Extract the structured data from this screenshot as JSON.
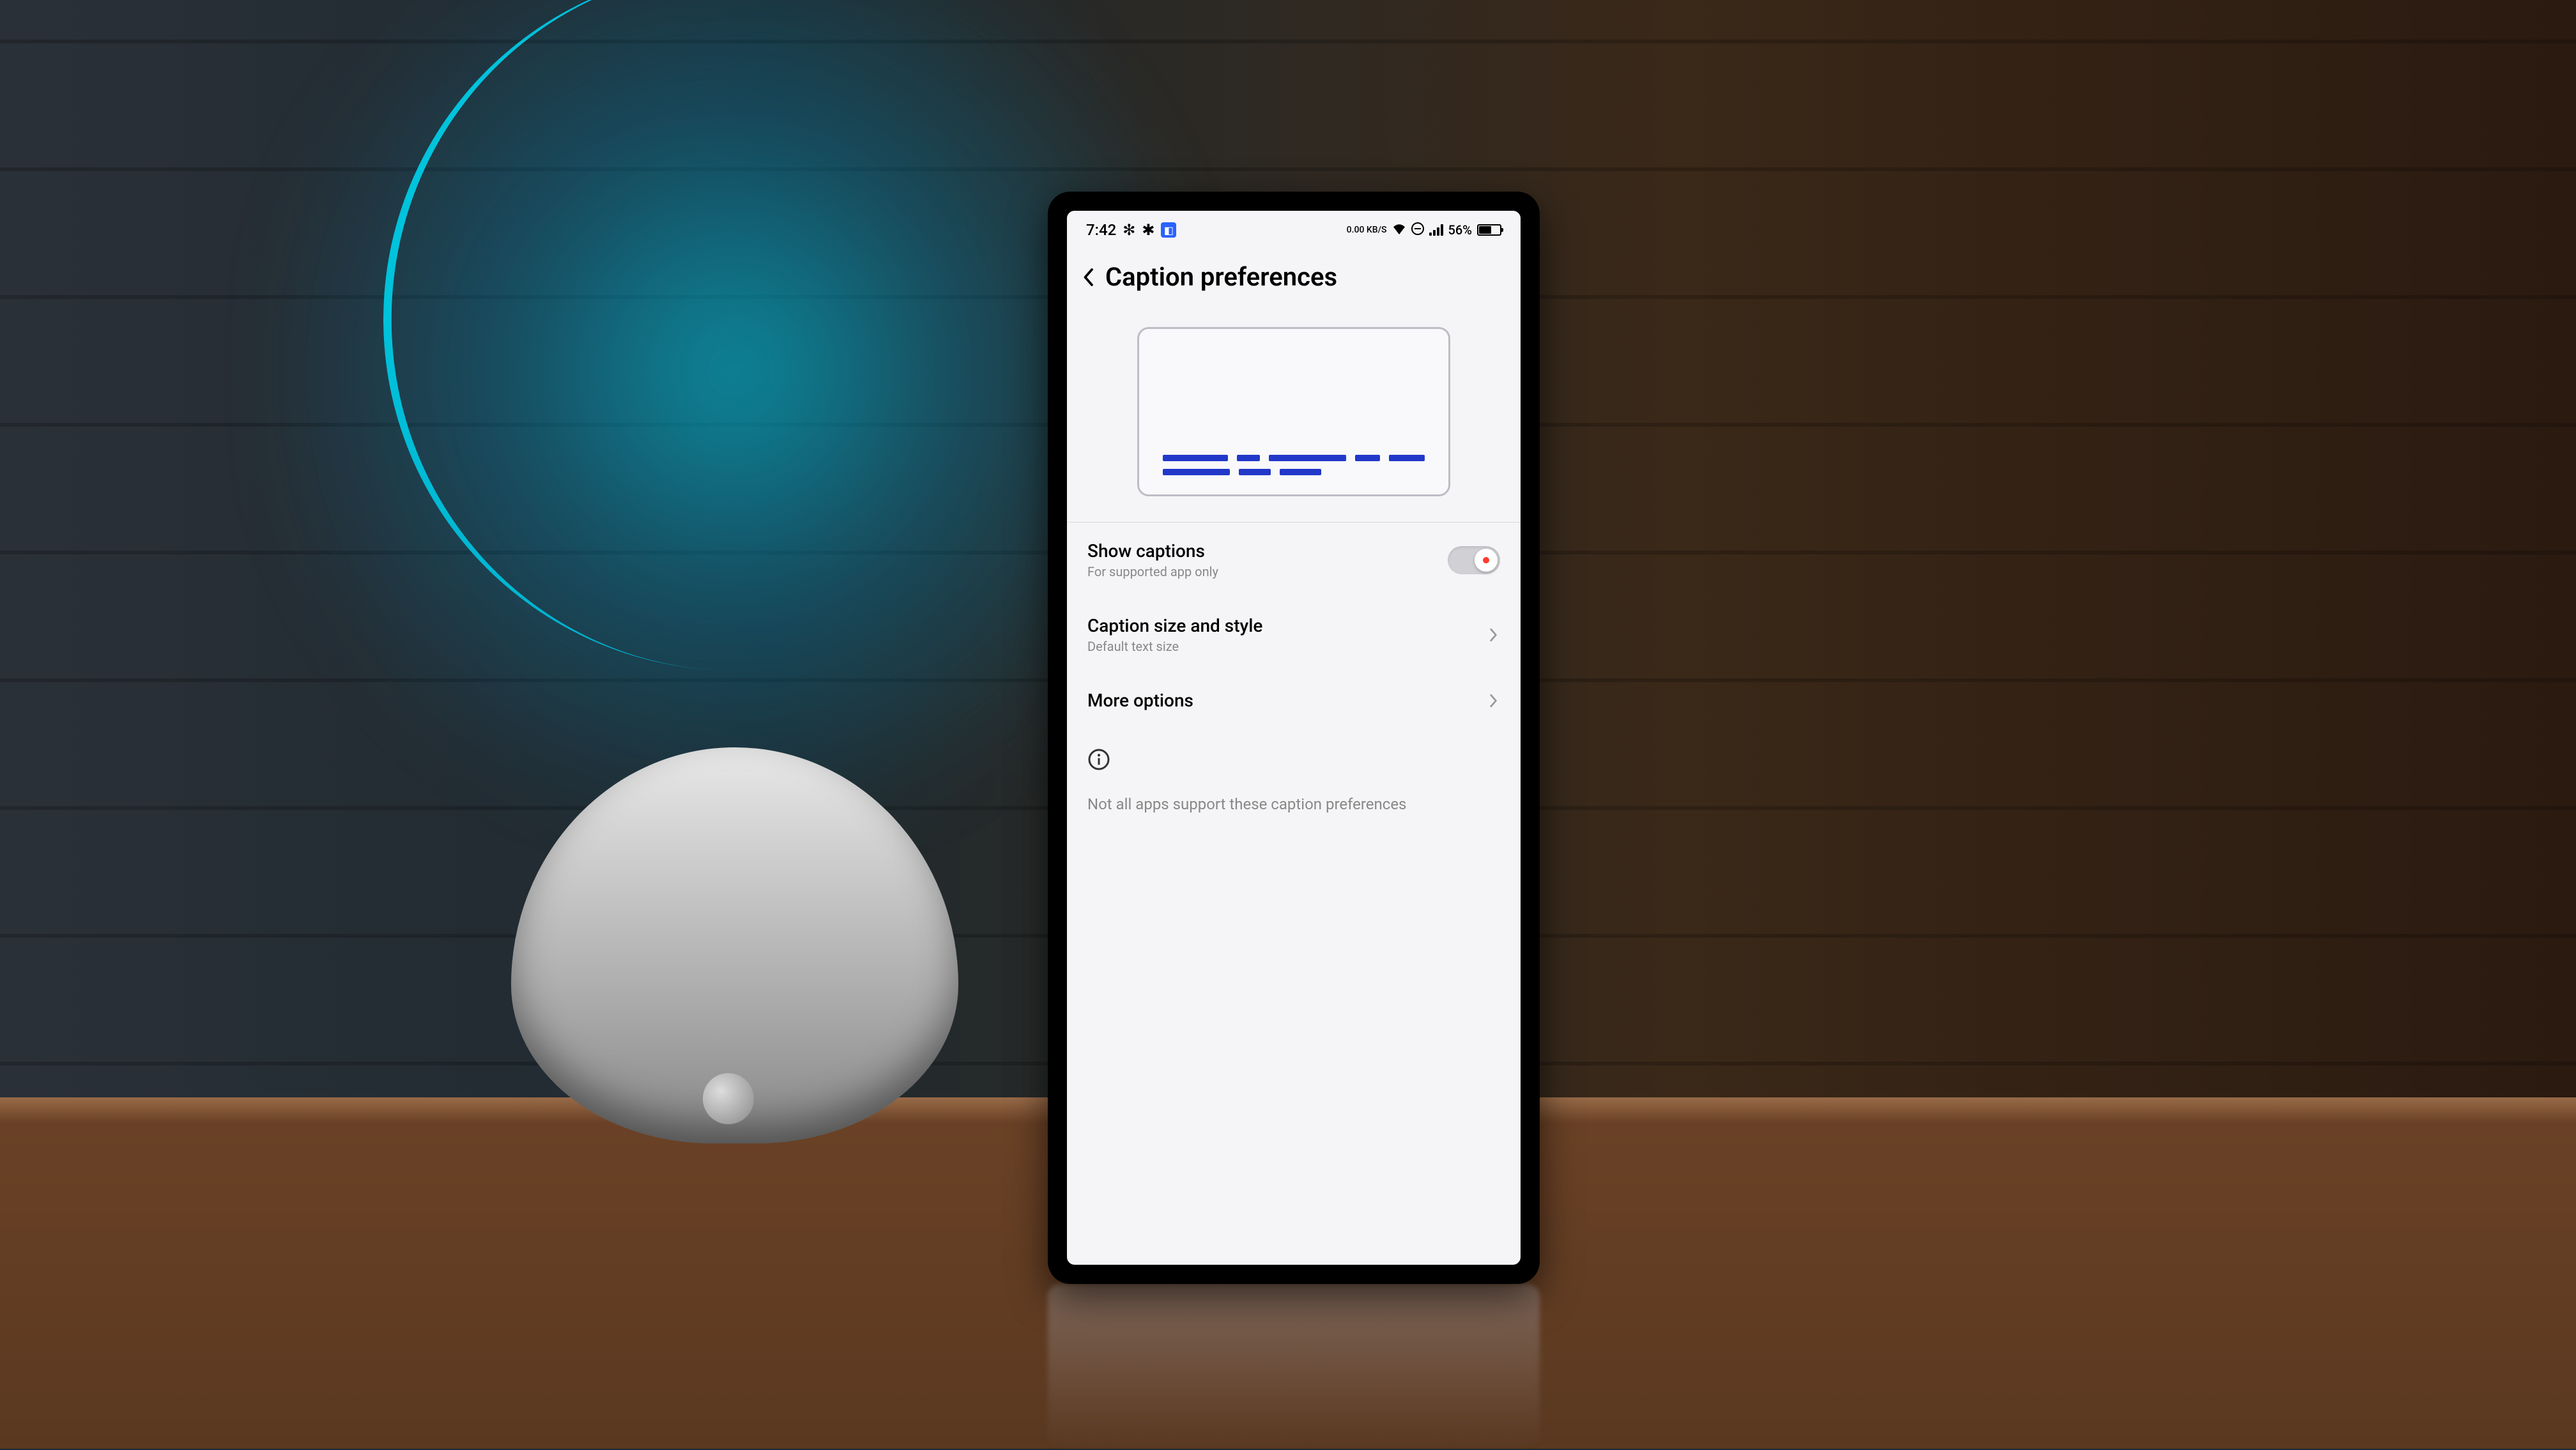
{
  "status_bar": {
    "time": "7:42",
    "data_label": "0.00 KB/S",
    "battery_text": "56%"
  },
  "header": {
    "title": "Caption preferences"
  },
  "settings": {
    "show_captions": {
      "title": "Show captions",
      "subtitle": "For supported app only",
      "enabled": true
    },
    "caption_style": {
      "title": "Caption size and style",
      "subtitle": "Default text size"
    },
    "more_options": {
      "title": "More options"
    }
  },
  "info": {
    "text": "Not all apps support these caption preferences"
  }
}
